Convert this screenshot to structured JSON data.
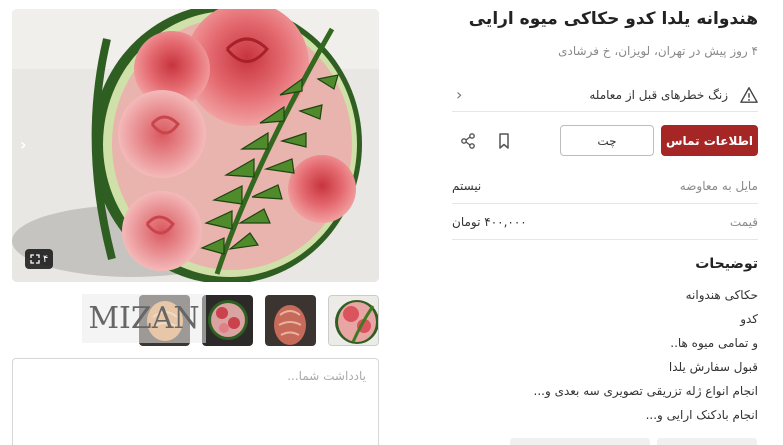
{
  "listing": {
    "title": "هندوانه یلدا کدو حکاکی میوه ارایی",
    "subtitle": "۴ روز پیش در تهران، لویزان، خ فرشادی"
  },
  "warning": {
    "text": "زنگ خطرهای قبل از معامله",
    "icon": "warning-triangle-icon"
  },
  "actions": {
    "contact_label": "اطلاعات تماس",
    "chat_label": "چت",
    "contact_color": "#a62626"
  },
  "attributes": [
    {
      "key": "مایل به معاوضه",
      "value": "نیستم"
    },
    {
      "key": "قیمت",
      "value": "۴۰۰,۰۰۰ تومان"
    }
  ],
  "description": {
    "title": "توضیحات",
    "lines": [
      "حکاکی هندوانه",
      "کدو",
      "و تمامی میوه ها..",
      "قبول سفارش یلدا",
      "انجام انواع ژله تزریقی تصویری سه بعدی و...",
      "انجام بادکنک ارایی و..."
    ]
  },
  "gallery": {
    "image_count": "۴",
    "watermark": "MIZAN"
  },
  "note": {
    "placeholder": "یادداشت شما..."
  }
}
